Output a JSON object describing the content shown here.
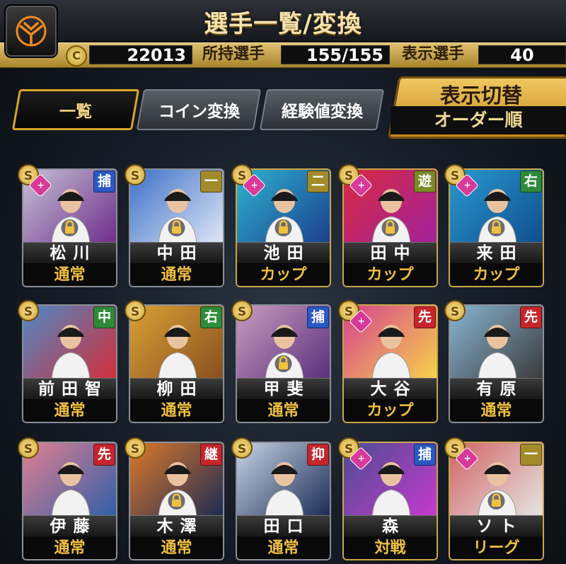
{
  "header": {
    "title": "選手一覧/変換",
    "coin_value": "22013",
    "owned_label": "所持選手",
    "owned_value": "155/155",
    "display_label": "表示選手",
    "display_value": "40",
    "coin_icon": "C"
  },
  "tabs": [
    {
      "label": "一覧",
      "active": true
    },
    {
      "label": "コイン変換",
      "active": false
    },
    {
      "label": "経験値変換",
      "active": false
    }
  ],
  "switch": {
    "title": "表示切替",
    "value": "オーダー順"
  },
  "position_colors": {
    "捕": "#2a58c4",
    "一": "#a38b2c",
    "二": "#a38b2c",
    "遊": "#7a8a27",
    "右": "#2e8b3a",
    "中": "#2e8b3a",
    "先": "#c6252c",
    "継": "#c6252c",
    "抑": "#c6252c"
  },
  "cards": [
    {
      "name": "松川",
      "type": "通常",
      "pos": "捕",
      "goku": true,
      "lock": true,
      "bg": "#c6c4d6",
      "accent": "#6e2d8a"
    },
    {
      "name": "中田",
      "type": "通常",
      "pos": "一",
      "goku": false,
      "lock": true,
      "bg": "#3a6fc8",
      "accent": "#dfe6f5"
    },
    {
      "name": "池田",
      "type": "カップ",
      "pos": "二",
      "goku": true,
      "lock": true,
      "bg": "#2fb4d0",
      "accent": "#1b3f8e"
    },
    {
      "name": "田中",
      "type": "カップ",
      "pos": "遊",
      "goku": true,
      "lock": true,
      "bg": "#d92b40",
      "accent": "#a0219c"
    },
    {
      "name": "来田",
      "type": "カップ",
      "pos": "右",
      "goku": true,
      "lock": true,
      "bg": "#2a9ad0",
      "accent": "#0f4e8e"
    },
    {
      "name": "前田智",
      "type": "通常",
      "pos": "中",
      "goku": false,
      "lock": false,
      "bg": "#4b8ac6",
      "accent": "#d32d3a"
    },
    {
      "name": "柳田",
      "type": "通常",
      "pos": "右",
      "goku": false,
      "lock": false,
      "bg": "#d9a334",
      "accent": "#8a4e20"
    },
    {
      "name": "甲斐",
      "type": "通常",
      "pos": "捕",
      "goku": false,
      "lock": true,
      "bg": "#c99fc0",
      "accent": "#5b2e7c"
    },
    {
      "name": "大谷",
      "type": "カップ",
      "pos": "先",
      "goku": true,
      "lock": false,
      "bg": "#d64090",
      "accent": "#f6d34a"
    },
    {
      "name": "有原",
      "type": "通常",
      "pos": "先",
      "goku": false,
      "lock": false,
      "bg": "#8ab8d6",
      "accent": "#3a3a3a"
    },
    {
      "name": "伊藤",
      "type": "通常",
      "pos": "先",
      "goku": false,
      "lock": false,
      "bg": "#e58090",
      "accent": "#2f5fa8"
    },
    {
      "name": "木澤",
      "type": "通常",
      "pos": "継",
      "goku": false,
      "lock": true,
      "bg": "#e07a28",
      "accent": "#1c2b55"
    },
    {
      "name": "田口",
      "type": "通常",
      "pos": "抑",
      "goku": false,
      "lock": false,
      "bg": "#c9d8e8",
      "accent": "#1c2b55"
    },
    {
      "name": "森",
      "type": "対戦",
      "pos": "捕",
      "goku": true,
      "lock": false,
      "bg": "#4a4d8e",
      "accent": "#c63ad0"
    },
    {
      "name": "ソト",
      "type": "リーグ",
      "pos": "一",
      "goku": true,
      "lock": true,
      "bg": "#d06262",
      "accent": "#e5e5e5"
    }
  ]
}
